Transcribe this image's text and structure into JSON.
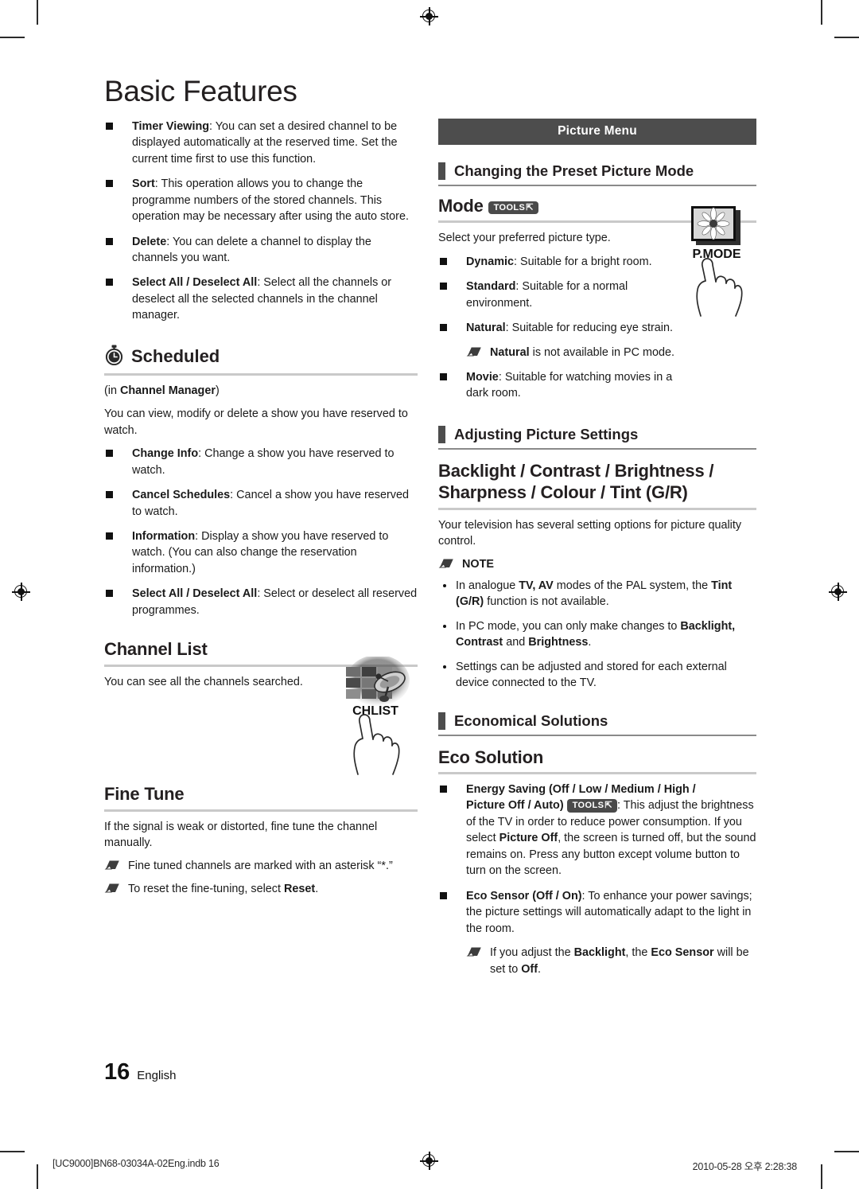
{
  "document": {
    "title": "Basic Features",
    "page_number": "16",
    "language": "English",
    "print_footer_left": "[UC9000]BN68-03034A-02Eng.indb   16",
    "print_footer_right": "2010-05-28   오후 2:28:38"
  },
  "left_column": {
    "top_bullets": [
      {
        "term": "Timer Viewing",
        "text": ": You can set a desired channel to be displayed automatically at the reserved time. Set the current time first to use this function."
      },
      {
        "term": "Sort",
        "text": ": This operation allows you to change the programme numbers of the stored channels. This operation may be necessary after using the auto store."
      },
      {
        "term": "Delete",
        "text": ": You can delete a channel to display the channels you want."
      },
      {
        "term": "Select All / Deselect All",
        "text": ": Select all the channels or deselect all the selected channels in the channel manager."
      }
    ],
    "scheduled": {
      "icon": "clock-icon",
      "heading": "Scheduled",
      "subtitle_prefix": "(in ",
      "subtitle_bold": "Channel Manager",
      "subtitle_suffix": ")",
      "intro": "You can view, modify or delete a show you have reserved to watch.",
      "bullets": [
        {
          "term": "Change Info",
          "text": ": Change a show you have reserved to watch."
        },
        {
          "term": "Cancel Schedules",
          "text": ": Cancel a show you have reserved to watch."
        },
        {
          "term": "Information",
          "text": ": Display a show you have reserved to watch. (You can also change the reservation information.)"
        },
        {
          "term": "Select All / Deselect All",
          "text": ": Select or deselect all reserved programmes."
        }
      ]
    },
    "channel_list": {
      "heading": "Channel List",
      "body": "You can see all the channels searched.",
      "key_label": "CHLIST",
      "key_icon": "channel-list-key-icon"
    },
    "fine_tune": {
      "heading": "Fine Tune",
      "body": "If the signal is weak or distorted, fine tune the channel manually.",
      "notes": [
        {
          "pre": "Fine tuned channels are marked with an asterisk “*.”",
          "bold": "",
          "post": ""
        },
        {
          "pre": "To reset the fine-tuning, select ",
          "bold": "Reset",
          "post": "."
        }
      ]
    }
  },
  "right_column": {
    "banner": "Picture Menu",
    "preset_section": {
      "heading": "Changing the Preset Picture Mode",
      "mode_heading": "Mode",
      "tools_badge": "TOOLS",
      "intro": "Select your preferred picture type.",
      "bullets": [
        {
          "term": "Dynamic",
          "text": ": Suitable for a bright room."
        },
        {
          "term": "Standard",
          "text": ": Suitable for a normal environment."
        },
        {
          "term": "Natural",
          "text": ": Suitable for reducing eye strain."
        },
        {
          "term": "Movie",
          "text": ": Suitable for watching movies in a dark room."
        }
      ],
      "natural_note_bold": "Natural",
      "natural_note_rest": " is not available in PC mode.",
      "key_label": "P.MODE",
      "key_icon": "picture-mode-key-icon"
    },
    "adjusting_section": {
      "heading": "Adjusting Picture Settings",
      "sub_heading_line1": "Backlight / Contrast / Brightness /",
      "sub_heading_line2": "Sharpness / Colour / Tint (G/R)",
      "body": "Your television has several setting options for picture quality control.",
      "note_label": "NOTE",
      "notes": [
        {
          "p1": "In analogue ",
          "b1": "TV, AV",
          "p2": " modes of the PAL system, the ",
          "b2": "Tint (G/R)",
          "p3": " function is not available."
        },
        {
          "p1": "In PC mode, you can only make changes to ",
          "b1": "Backlight, Contrast",
          "p2": " and ",
          "b2": "Brightness",
          "p3": "."
        },
        {
          "p1": "Settings can be adjusted and stored for each external device connected to the TV.",
          "b1": "",
          "p2": "",
          "b2": "",
          "p3": ""
        }
      ]
    },
    "economical_section": {
      "heading": "Economical Solutions",
      "eco_heading": "Eco Solution",
      "energy_saving": {
        "term_line1": "Energy Saving (Off / Low / Medium / High /",
        "term_line2": "Picture Off / Auto)",
        "tools_badge": "TOOLS",
        "text_a": ": This adjust the brightness of the TV in order to reduce power consumption. If you select  ",
        "bold_a": "Picture Off",
        "text_b": ", the screen is turned off, but the sound remains on. Press any button except volume button to turn on the screen."
      },
      "eco_sensor": {
        "term": "Eco Sensor (Off / On)",
        "text": ": To enhance your power savings; the picture settings will automatically adapt to the light in the room.",
        "note_pre": "If you adjust the ",
        "note_b1": "Backlight",
        "note_mid": ", the ",
        "note_b2": "Eco Sensor",
        "note_post": " will be set to ",
        "note_b3": "Off",
        "note_end": "."
      }
    }
  },
  "colors": {
    "banner_bg": "#4d4d4d",
    "bar_accent": "#4d4d4d",
    "rule": "#c9c9c9",
    "text": "#1a1a1a"
  }
}
